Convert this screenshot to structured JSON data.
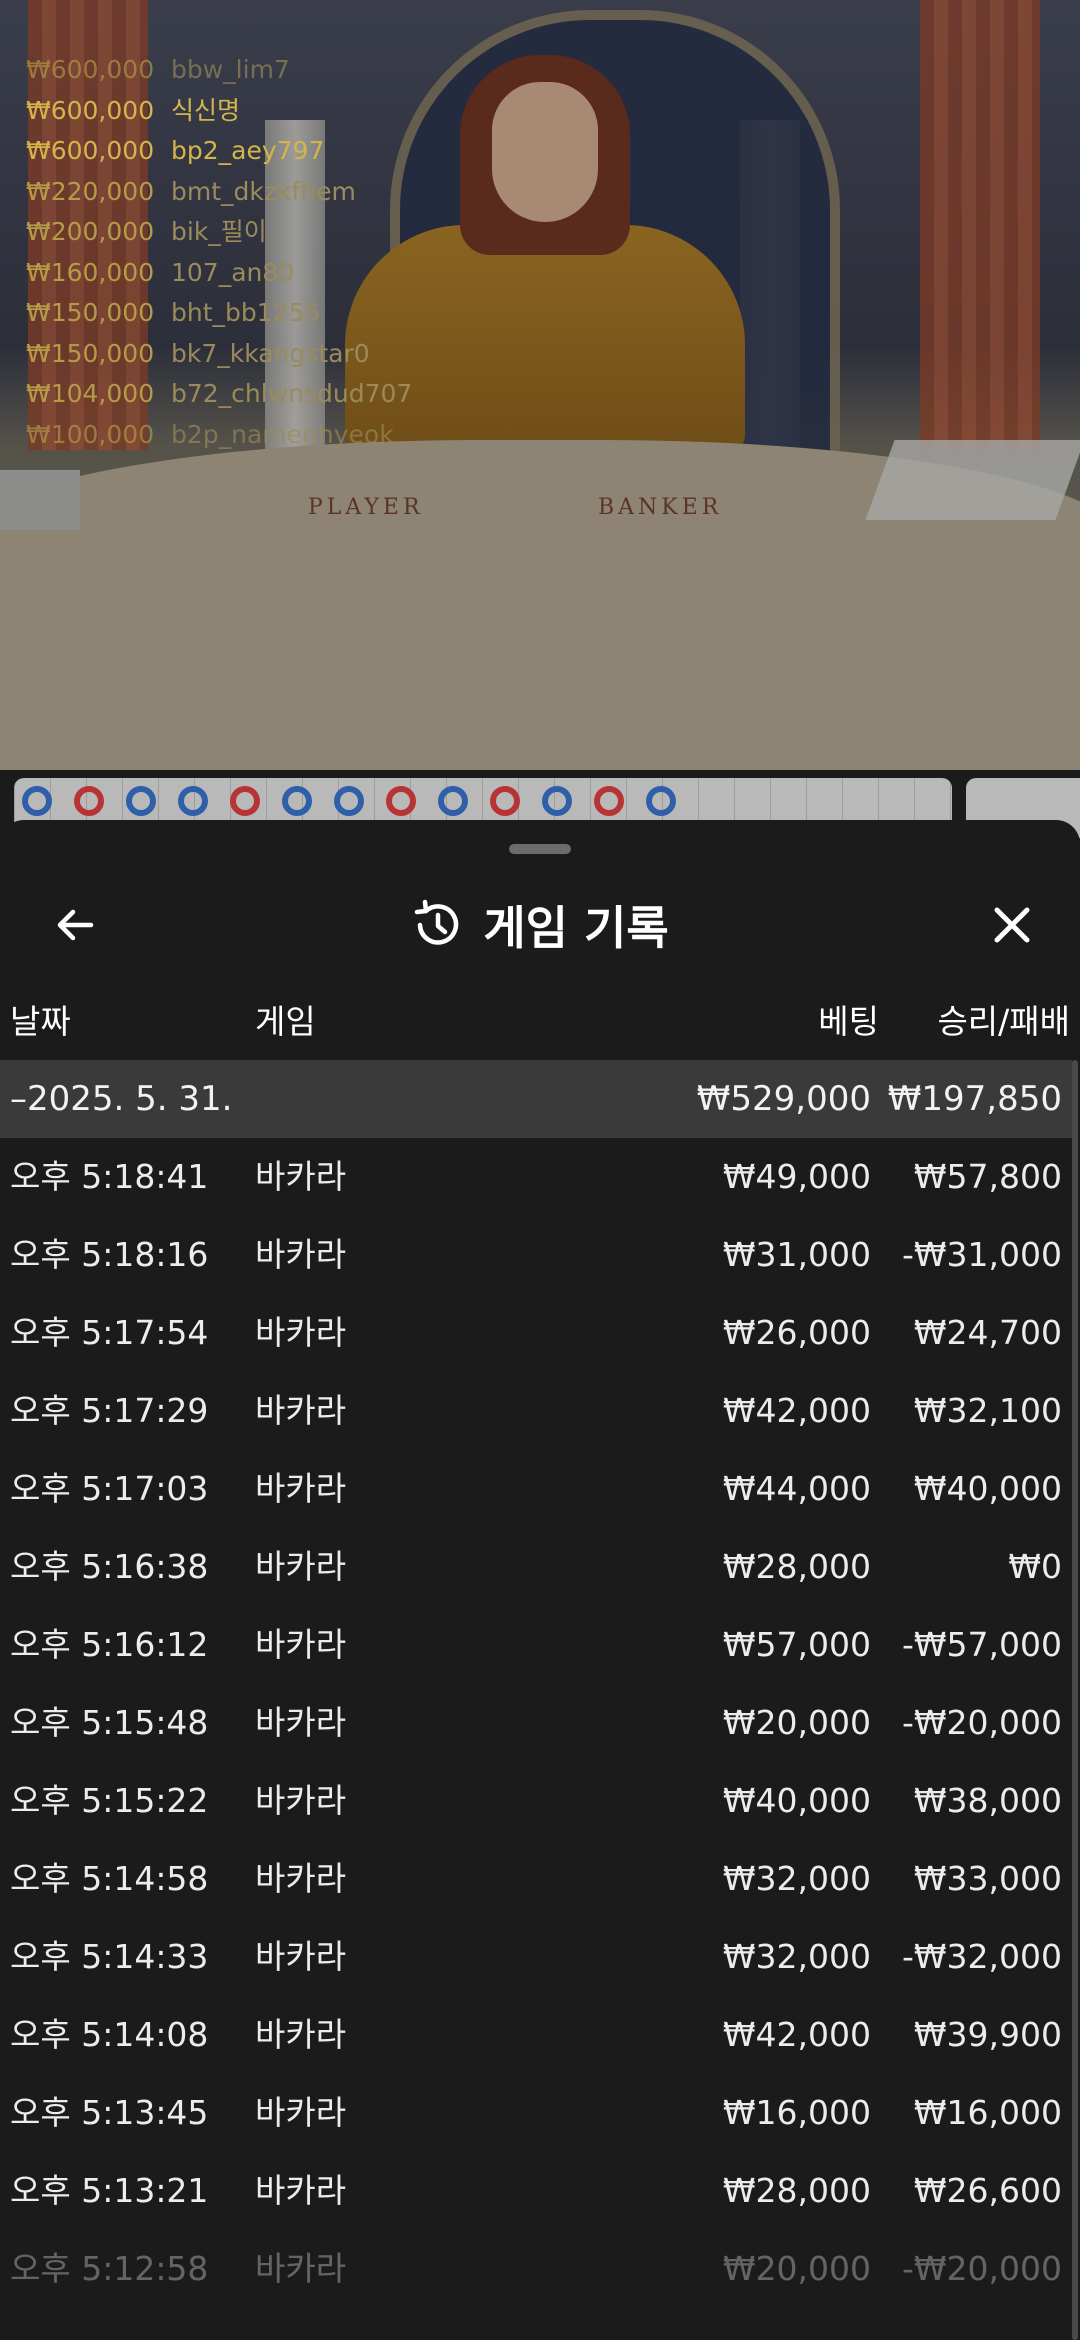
{
  "leaderboard": [
    {
      "amount": "₩600,000",
      "name": "bbw_lim7"
    },
    {
      "amount": "₩600,000",
      "name": "식신명"
    },
    {
      "amount": "₩600,000",
      "name": "bp2_aey797"
    },
    {
      "amount": "₩220,000",
      "name": "bmt_dkzkfhem"
    },
    {
      "amount": "₩200,000",
      "name": "bik_필이"
    },
    {
      "amount": "₩160,000",
      "name": "107_an80"
    },
    {
      "amount": "₩150,000",
      "name": "bht_bb1255"
    },
    {
      "amount": "₩150,000",
      "name": "bk7_kkangstar0"
    },
    {
      "amount": "₩104,000",
      "name": "b72_chlwnsdud707"
    },
    {
      "amount": "₩100,000",
      "name": "b2p_namenhyeok"
    }
  ],
  "table_labels": {
    "player": "PLAYER",
    "banker": "BANKER"
  },
  "road_beads": [
    "blue",
    "red",
    "blue",
    "blue",
    "red",
    "blue",
    "blue",
    "red",
    "blue",
    "red",
    "blue",
    "red",
    "blue"
  ],
  "history": {
    "title": "게임 기록",
    "icons": {
      "back": "arrow-left-icon",
      "history": "history-clock-icon",
      "close": "close-icon"
    },
    "columns": {
      "date": "날짜",
      "game": "게임",
      "bet": "베팅",
      "winloss": "승리/패배"
    },
    "summary": {
      "date": "–2025. 5. 31.",
      "bet": "₩529,000",
      "winloss": "₩197,850"
    },
    "rows": [
      {
        "time": "오후 5:18:41",
        "game": "바카라",
        "bet": "₩49,000",
        "winloss": "₩57,800"
      },
      {
        "time": "오후 5:18:16",
        "game": "바카라",
        "bet": "₩31,000",
        "winloss": "-₩31,000"
      },
      {
        "time": "오후 5:17:54",
        "game": "바카라",
        "bet": "₩26,000",
        "winloss": "₩24,700"
      },
      {
        "time": "오후 5:17:29",
        "game": "바카라",
        "bet": "₩42,000",
        "winloss": "₩32,100"
      },
      {
        "time": "오후 5:17:03",
        "game": "바카라",
        "bet": "₩44,000",
        "winloss": "₩40,000"
      },
      {
        "time": "오후 5:16:38",
        "game": "바카라",
        "bet": "₩28,000",
        "winloss": "₩0"
      },
      {
        "time": "오후 5:16:12",
        "game": "바카라",
        "bet": "₩57,000",
        "winloss": "-₩57,000"
      },
      {
        "time": "오후 5:15:48",
        "game": "바카라",
        "bet": "₩20,000",
        "winloss": "-₩20,000"
      },
      {
        "time": "오후 5:15:22",
        "game": "바카라",
        "bet": "₩40,000",
        "winloss": "₩38,000"
      },
      {
        "time": "오후 5:14:58",
        "game": "바카라",
        "bet": "₩32,000",
        "winloss": "₩33,000"
      },
      {
        "time": "오후 5:14:33",
        "game": "바카라",
        "bet": "₩32,000",
        "winloss": "-₩32,000"
      },
      {
        "time": "오후 5:14:08",
        "game": "바카라",
        "bet": "₩42,000",
        "winloss": "₩39,900"
      },
      {
        "time": "오후 5:13:45",
        "game": "바카라",
        "bet": "₩16,000",
        "winloss": "₩16,000"
      },
      {
        "time": "오후 5:13:21",
        "game": "바카라",
        "bet": "₩28,000",
        "winloss": "₩26,600"
      },
      {
        "time": "오후 5:12:58",
        "game": "바카라",
        "bet": "₩20,000",
        "winloss": "-₩20,000"
      }
    ]
  }
}
